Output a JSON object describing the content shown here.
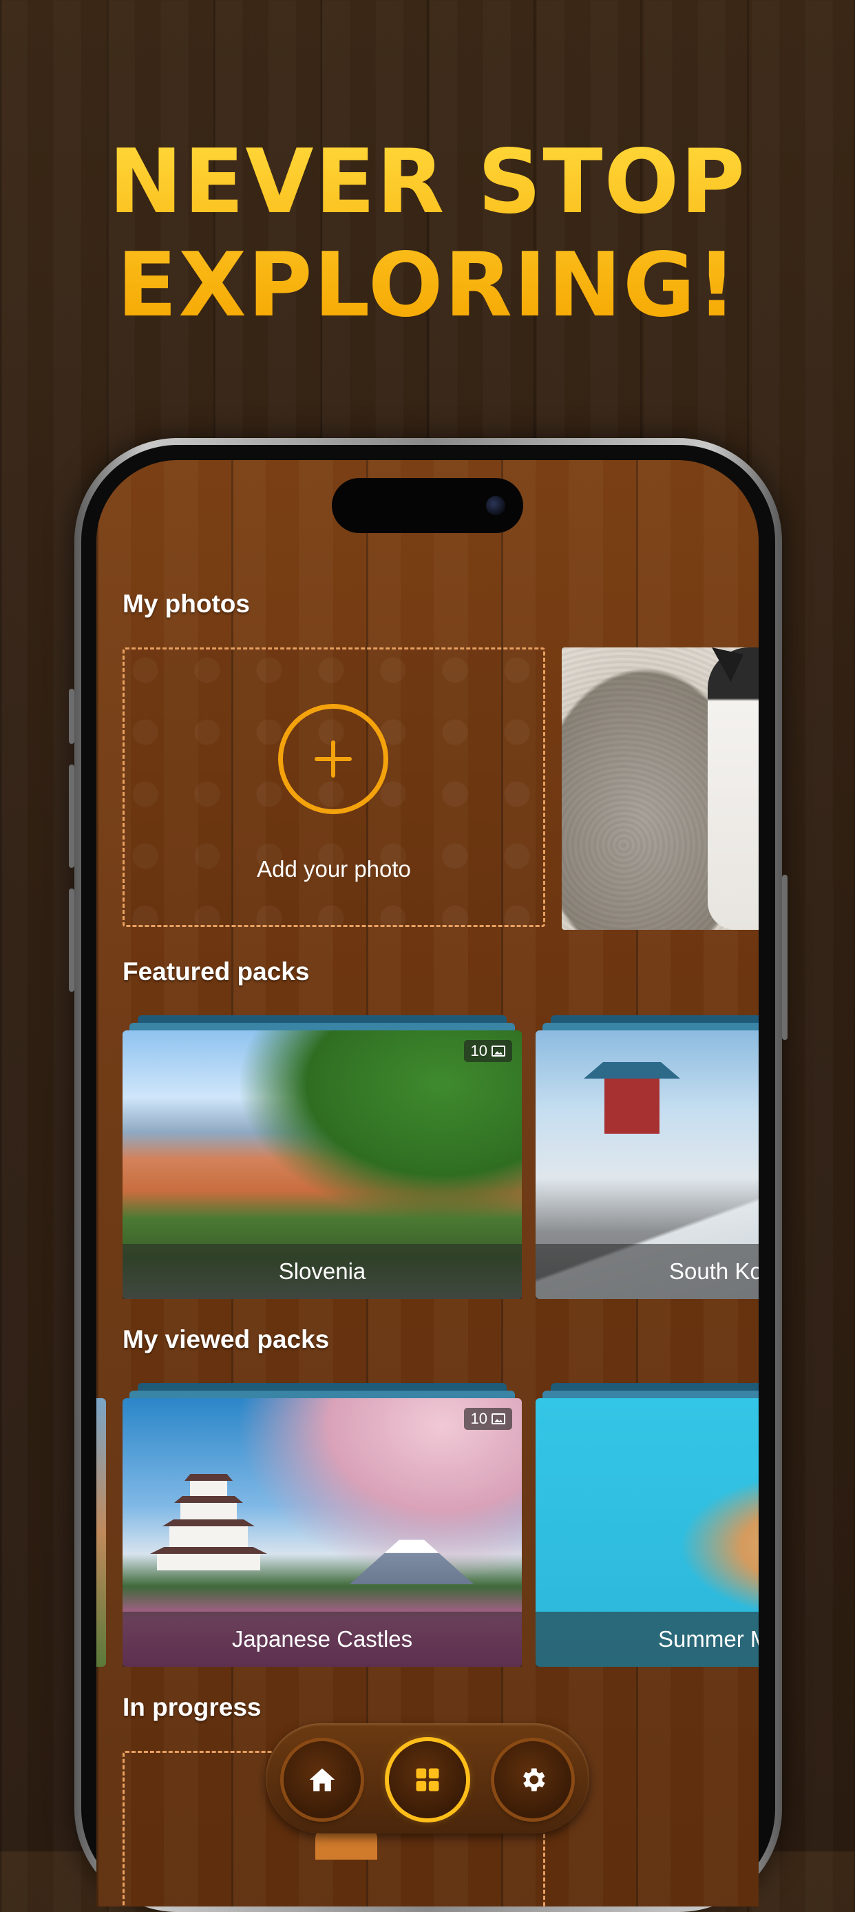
{
  "headline": {
    "line1": "NEVER STOP",
    "line2": "EXPLORING!"
  },
  "sections": {
    "my_photos": "My photos",
    "featured_packs": "Featured packs",
    "my_viewed_packs": "My viewed packs",
    "in_progress": "In progress"
  },
  "add_photo": {
    "label": "Add your photo"
  },
  "featured": [
    {
      "name": "Slovenia",
      "count": "10"
    },
    {
      "name": "South Ko",
      "count": ""
    }
  ],
  "viewed": [
    {
      "name": "Japanese Castles",
      "count": "10"
    },
    {
      "name": "Summer M",
      "count": ""
    }
  ],
  "nav": {
    "items": [
      {
        "icon": "home-icon"
      },
      {
        "icon": "grid-icon",
        "active": true
      },
      {
        "icon": "gear-icon"
      }
    ]
  },
  "colors": {
    "accent": "#ffbe1a",
    "headline": "#ffc21a",
    "pack_caption_bg": "rgba(40,40,40,0.55)"
  }
}
